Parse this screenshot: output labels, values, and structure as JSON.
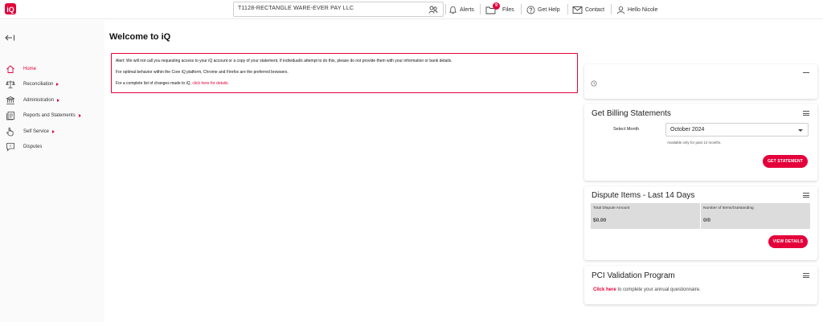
{
  "brand": {
    "accent": "#e4003a",
    "logo_icon": "iq-logo-icon"
  },
  "header": {
    "merchant": "T1128-RECTANGLE WARE-EVER PAY LLC",
    "alerts_label": "Alerts",
    "files_label": "Files",
    "files_badge": "9",
    "help_label": "Get Help",
    "contact_label": "Contact",
    "user_label": "Hello Nicole"
  },
  "sidebar": {
    "items": [
      {
        "label": "Home",
        "icon": "home-icon",
        "active": true,
        "has_children": false
      },
      {
        "label": "Reconciliation",
        "icon": "scales-icon",
        "active": false,
        "has_children": true
      },
      {
        "label": "Administration",
        "icon": "bank-icon",
        "active": false,
        "has_children": true
      },
      {
        "label": "Reports and Statements",
        "icon": "report-icon",
        "active": false,
        "has_children": true
      },
      {
        "label": "Self Service",
        "icon": "pointer-hand-icon",
        "active": false,
        "has_children": true
      },
      {
        "label": "Disputes",
        "icon": "chat-icon",
        "active": false,
        "has_children": false
      }
    ]
  },
  "main": {
    "title": "Welcome to iQ",
    "alert": {
      "line1": "Alert: We will not call you requesting access to your iQ account or a copy of your statement. If individual/s attempt to do this, please do not provide them with your information or bank details.",
      "line2": "For optimal behavior within the Core iQ platform, Chrome and Firefox are the preferred browsers.",
      "line3_prefix": "For a complete list of changes made to iQ, ",
      "line3_link": "click here for details."
    }
  },
  "billing": {
    "title": "Get Billing Statements",
    "select_label": "Select Month",
    "selected_month": "October 2024",
    "help_text": "Available only for past 12 months.",
    "button_label": "GET STATEMENT"
  },
  "disputes": {
    "title": "Dispute Items - Last 14 Days",
    "total_label": "Total Dispute Amount",
    "total_value": "$0.00",
    "count_label": "Number of Items/Outstanding",
    "count_value": "0/0",
    "button_label": "VIEW DETAILS"
  },
  "pci": {
    "title": "PCI Validation Program",
    "link_text": "Click here",
    "suffix_text": " to complete your annual questionnaire."
  }
}
